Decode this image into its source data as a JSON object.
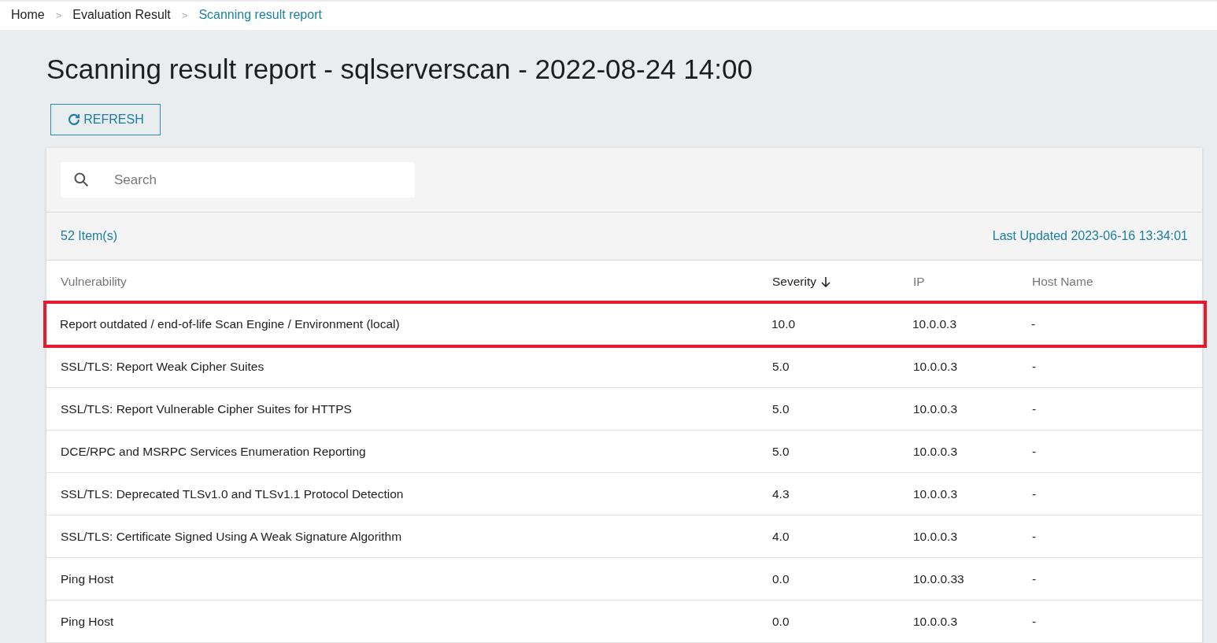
{
  "breadcrumb": [
    {
      "label": "Home",
      "current": false
    },
    {
      "label": "Evaluation Result",
      "current": false
    },
    {
      "label": "Scanning result report",
      "current": true
    }
  ],
  "breadcrumb_separator": ">",
  "title": "Scanning result report - sqlserverscan - 2022-08-24 14:00",
  "refresh_button": "REFRESH",
  "search": {
    "placeholder": "Search"
  },
  "item_count": "52 Item(s)",
  "last_updated": "Last Updated 2023-06-16 13:34:01",
  "table": {
    "columns": [
      {
        "label": "Vulnerability",
        "sorted": false
      },
      {
        "label": "Severity",
        "sorted": true
      },
      {
        "label": "IP",
        "sorted": false
      },
      {
        "label": "Host Name",
        "sorted": false
      }
    ],
    "rows": [
      {
        "cells": [
          "Report outdated / end-of-life Scan Engine / Environment (local)",
          "10.0",
          "10.0.0.3",
          "-"
        ],
        "highlighted": true
      },
      {
        "cells": [
          "SSL/TLS: Report Weak Cipher Suites",
          "5.0",
          "10.0.0.3",
          "-"
        ],
        "highlighted": false
      },
      {
        "cells": [
          "SSL/TLS: Report Vulnerable Cipher Suites for HTTPS",
          "5.0",
          "10.0.0.3",
          "-"
        ],
        "highlighted": false
      },
      {
        "cells": [
          "DCE/RPC and MSRPC Services Enumeration Reporting",
          "5.0",
          "10.0.0.3",
          "-"
        ],
        "highlighted": false
      },
      {
        "cells": [
          "SSL/TLS: Deprecated TLSv1.0 and TLSv1.1 Protocol Detection",
          "4.3",
          "10.0.0.3",
          "-"
        ],
        "highlighted": false
      },
      {
        "cells": [
          "SSL/TLS: Certificate Signed Using A Weak Signature Algorithm",
          "4.0",
          "10.0.0.3",
          "-"
        ],
        "highlighted": false
      },
      {
        "cells": [
          "Ping Host",
          "0.0",
          "10.0.0.33",
          "-"
        ],
        "highlighted": false
      },
      {
        "cells": [
          "Ping Host",
          "0.0",
          "10.0.0.3",
          "-"
        ],
        "highlighted": false
      }
    ]
  }
}
